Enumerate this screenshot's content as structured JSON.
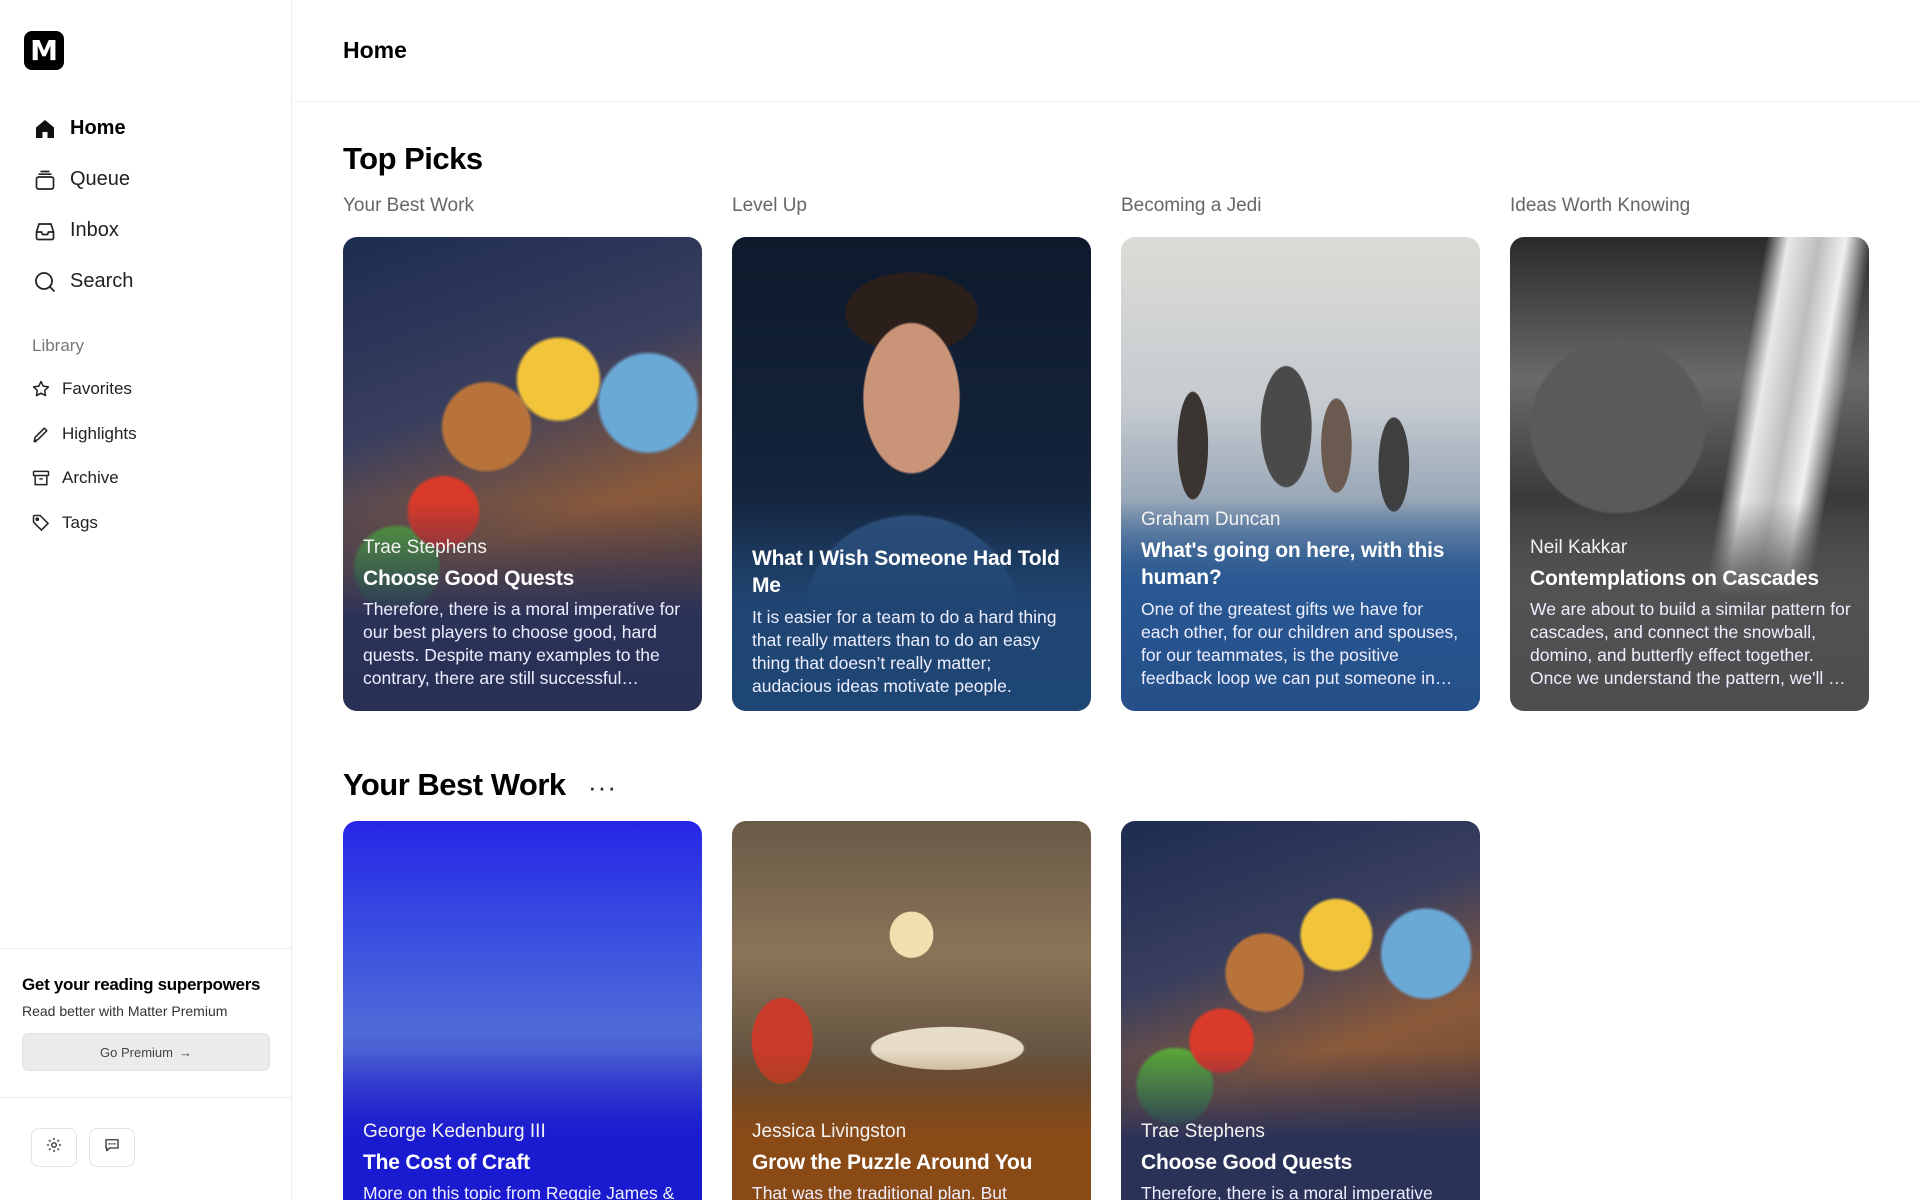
{
  "app": {
    "logo_letter": "M",
    "page_title": "Home"
  },
  "nav": {
    "items": [
      {
        "label": "Home",
        "icon": "home-icon"
      },
      {
        "label": "Queue",
        "icon": "queue-icon"
      },
      {
        "label": "Inbox",
        "icon": "inbox-icon"
      },
      {
        "label": "Search",
        "icon": "search-icon"
      }
    ]
  },
  "library": {
    "heading": "Library",
    "items": [
      {
        "label": "Favorites",
        "icon": "star-icon"
      },
      {
        "label": "Highlights",
        "icon": "pencil-icon"
      },
      {
        "label": "Archive",
        "icon": "archive-icon"
      },
      {
        "label": "Tags",
        "icon": "tag-icon"
      }
    ]
  },
  "promo": {
    "title": "Get your reading superpowers",
    "subtitle": "Read better with Matter Premium",
    "button": "Go Premium",
    "button_arrow": "→"
  },
  "footer": {
    "settings_icon": "gear-icon",
    "feedback_icon": "chat-icon"
  },
  "top_picks": {
    "title": "Top Picks",
    "columns": [
      {
        "label": "Your Best Work",
        "author": "Trae Stephens",
        "title": "Choose Good Quests",
        "excerpt": "Therefore, there is a moral imperative for our best players to choose good, hard quests. Despite many examples to the contrary, there are still successful companies doing hard things."
      },
      {
        "label": "Level Up",
        "author": "",
        "title": "What I Wish Someone Had Told Me",
        "excerpt": "It is easier for a team to do a hard thing that really matters than to do an easy thing that doesn’t really matter; audacious ideas motivate people."
      },
      {
        "label": "Becoming a Jedi",
        "author": "Graham Duncan",
        "title": "What's going on here, with this human?",
        "excerpt": "One of the greatest gifts we have for each other, for our children and spouses, for our teammates, is the positive feedback loop we can put someone in when we see them."
      },
      {
        "label": "Ideas Worth Knowing",
        "author": "Neil Kakkar",
        "title": "Contemplations on Cascades",
        "excerpt": "We are about to build a similar pattern for cascades, and connect the snowball, domino, and butterfly effect together. Once we understand the pattern, we'll be able to see it everywhere."
      }
    ]
  },
  "best_work": {
    "title": "Your Best Work",
    "more": "···",
    "cards": [
      {
        "author": "George Kedenburg III",
        "title": "The Cost of Craft",
        "excerpt": "More on this topic from Reggie James &"
      },
      {
        "author": "Jessica Livingston",
        "title": "Grow the Puzzle Around You",
        "excerpt": "That was the traditional plan. But"
      },
      {
        "author": "Trae Stephens",
        "title": "Choose Good Quests",
        "excerpt": "Therefore, there is a moral imperative"
      }
    ]
  }
}
